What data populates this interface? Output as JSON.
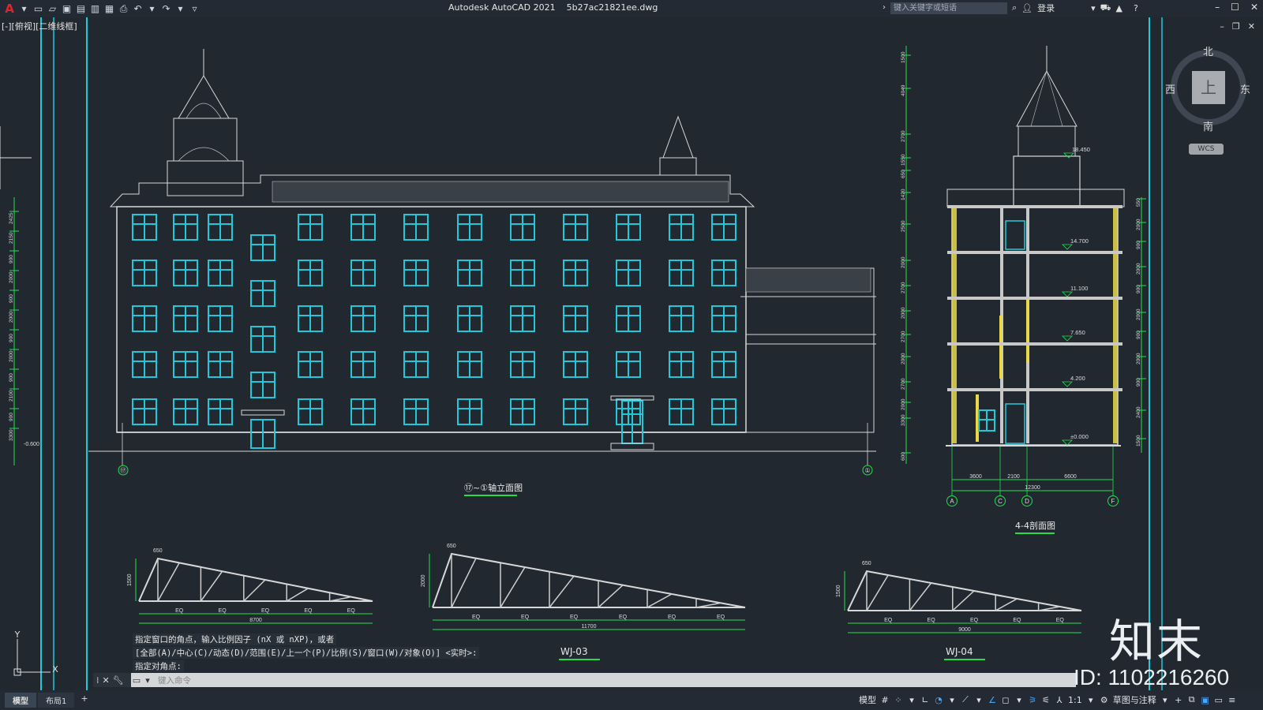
{
  "app": {
    "title": "Autodesk AutoCAD 2021",
    "filename": "5b27ac21821ee.dwg"
  },
  "search": {
    "placeholder": "键入关键字或短语"
  },
  "account": {
    "login_label": "登录"
  },
  "viewport": {
    "label": "[-][俯视][二维线框]"
  },
  "viewcube": {
    "north": "北",
    "south": "南",
    "east": "东",
    "west": "西",
    "face": "上",
    "wcs": "WCS"
  },
  "drawing": {
    "elevation_title": "⑰~①轴立面图",
    "section_title": "4-4剖面图",
    "axis_left": "⑰",
    "axis_right": "①",
    "left_level": "-0.600",
    "section_levels": [
      "18.450",
      "14.700",
      "11.100",
      "7.650",
      "4.200",
      "±0.000"
    ],
    "section_axes": [
      "A",
      "C",
      "D",
      "F"
    ],
    "section_dims": [
      "3600",
      "2100",
      "6600"
    ],
    "section_total": "12300",
    "left_dims": [
      "2425",
      "2150",
      "900",
      "2000",
      "900",
      "2000",
      "900",
      "2000",
      "900",
      "2100",
      "900",
      "3300"
    ],
    "section_left_dims": [
      "1500",
      "4049",
      "2700",
      "1550",
      "650",
      "1420",
      "2500",
      "2000",
      "2700",
      "2000",
      "2700",
      "2000",
      "2700",
      "2000",
      "3300",
      "600"
    ],
    "section_right_dims": [
      "550",
      "2000",
      "900",
      "2000",
      "900",
      "2000",
      "900",
      "2000",
      "900",
      "2400",
      "1500"
    ],
    "trusses": [
      {
        "id": "WJ-01",
        "label": "",
        "h": "1500",
        "top": "650",
        "span": "8700",
        "eq": [
          "EQ",
          "EQ",
          "EQ",
          "EQ",
          "EQ"
        ]
      },
      {
        "id": "WJ-03",
        "label": "WJ-03",
        "h": "2000",
        "top": "650",
        "span": "11700",
        "eq": [
          "EQ",
          "EQ",
          "EQ",
          "EQ",
          "EQ",
          "EQ"
        ]
      },
      {
        "id": "WJ-04",
        "label": "WJ-04",
        "h": "1500",
        "top": "650",
        "span": "9000",
        "eq": [
          "EQ",
          "EQ",
          "EQ",
          "EQ",
          "EQ"
        ]
      }
    ]
  },
  "command": {
    "history": [
      "指定窗口的角点，输入比例因子 (nX 或 nXP)，或者",
      "[全部(A)/中心(C)/动态(D)/范围(E)/上一个(P)/比例(S)/窗口(W)/对象(O)] <实时>:",
      "指定对角点:"
    ],
    "placeholder": "键入命令"
  },
  "tabs": [
    "模型",
    "布局1"
  ],
  "status": {
    "model_label": "模型",
    "scale": "1:1",
    "workspace": "草图与注释"
  },
  "watermark": {
    "brand": "知末",
    "id": "ID: 1102216260"
  },
  "colors": {
    "window": "#22c8d8",
    "background": "#212830",
    "accent_green": "#22e04a",
    "yellow": "#e8d84a"
  }
}
